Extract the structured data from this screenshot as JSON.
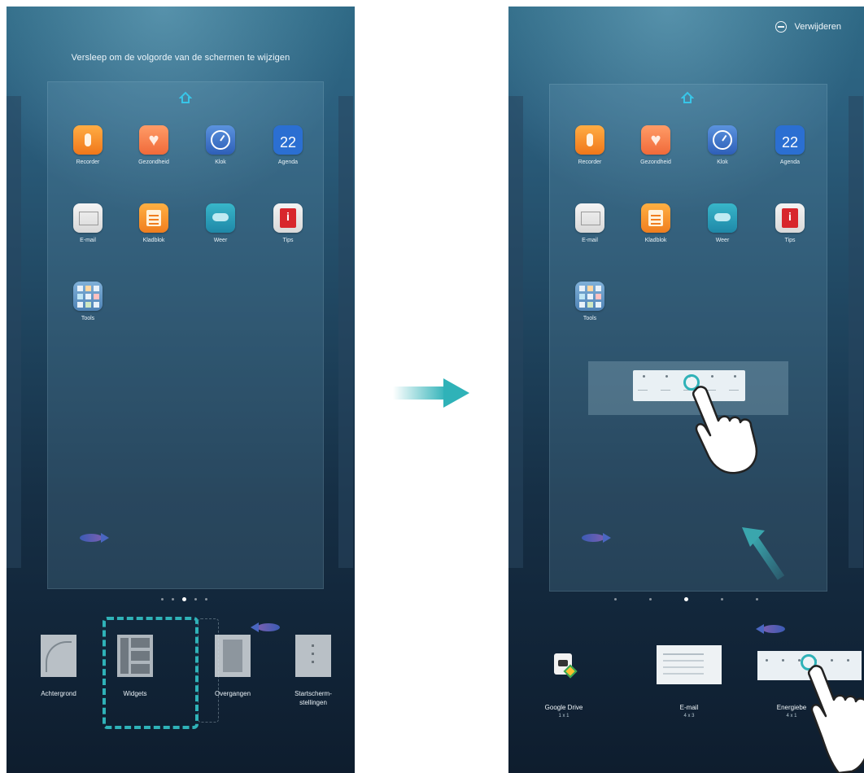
{
  "left_screen": {
    "hint": "Versleep om de volgorde van de schermen te wijzigen",
    "apps": [
      {
        "name": "Recorder",
        "icon": "recorder-icon"
      },
      {
        "name": "Gezondheid",
        "icon": "health-icon"
      },
      {
        "name": "Klok",
        "icon": "clock-icon"
      },
      {
        "name": "Agenda",
        "icon": "calendar-icon",
        "day": "22"
      },
      {
        "name": "E-mail",
        "icon": "email-icon"
      },
      {
        "name": "Kladblok",
        "icon": "notepad-icon"
      },
      {
        "name": "Weer",
        "icon": "weather-icon"
      },
      {
        "name": "Tips",
        "icon": "tips-icon"
      },
      {
        "name": "Tools",
        "icon": "tools-icon"
      }
    ],
    "options": [
      {
        "label": "Achtergrond"
      },
      {
        "label": "Widgets"
      },
      {
        "label": "Overgangen"
      },
      {
        "label": "Startscherm-",
        "label2": "stellingen"
      }
    ]
  },
  "right_screen": {
    "remove_label": "Verwijderen",
    "apps": [
      {
        "name": "Recorder"
      },
      {
        "name": "Gezondheid"
      },
      {
        "name": "Klok"
      },
      {
        "name": "Agenda",
        "day": "22"
      },
      {
        "name": "E-mail"
      },
      {
        "name": "Kladblok"
      },
      {
        "name": "Weer"
      },
      {
        "name": "Tips"
      },
      {
        "name": "Tools"
      }
    ],
    "widgets": [
      {
        "label": "Google Drive",
        "size": "1 x 1"
      },
      {
        "label": "E-mail",
        "size": "4 x 3"
      },
      {
        "label": "Energiebe",
        "size": "4 x 1"
      }
    ]
  },
  "colors": {
    "accent": "#2fb2b8",
    "background_top": "#2f6a86",
    "background_bottom": "#0e1d2e"
  }
}
